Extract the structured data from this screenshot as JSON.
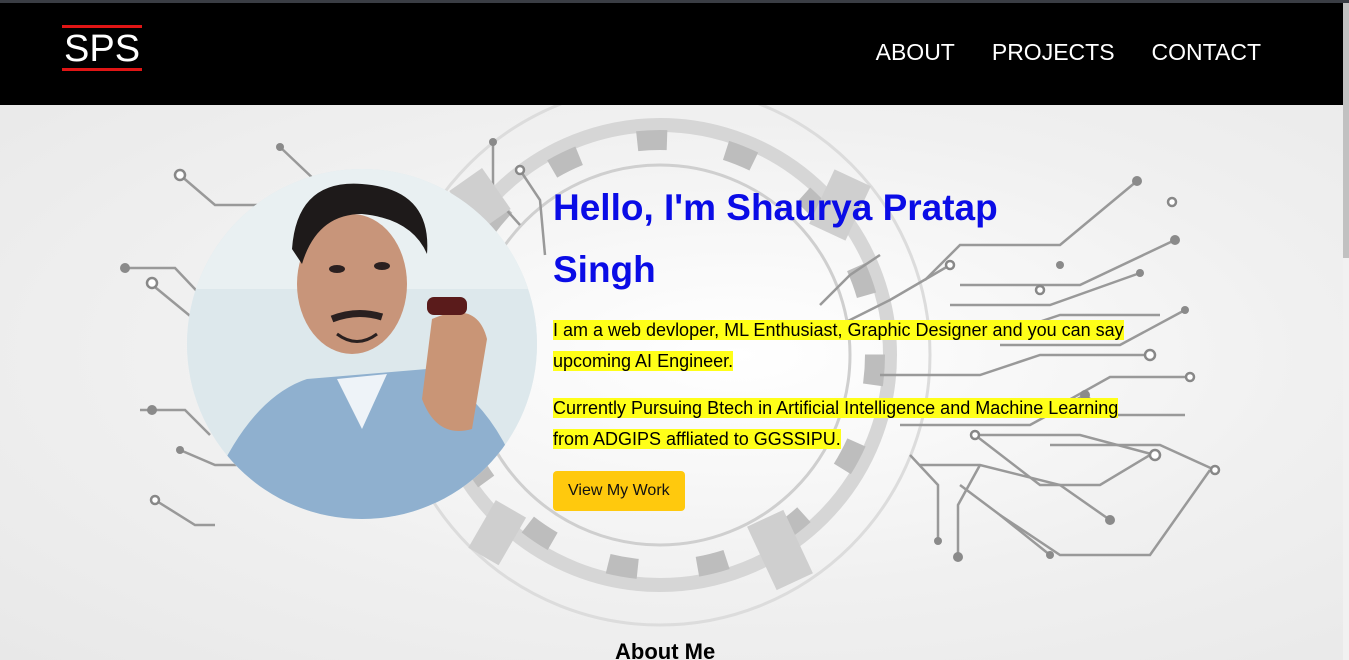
{
  "nav": {
    "logo": "SPS",
    "links": [
      "ABOUT",
      "PROJECTS",
      "CONTACT"
    ]
  },
  "hero": {
    "headline": "Hello, I'm Shaurya Pratap Singh",
    "paragraph1": "I am a web devloper, ML Enthusiast, Graphic Designer and you can say upcoming AI Engineer.",
    "paragraph2": "Currently Pursuing Btech in Artificial Intelligence and Machine Learning from ADGIPS affliated to GGSSIPU.",
    "button_label": "View My Work"
  },
  "about": {
    "title": "About Me"
  },
  "colors": {
    "nav_background": "#000000",
    "logo_accent": "#e01515",
    "headline": "#0a0ce6",
    "highlight": "#ffff18",
    "button": "#ffc90d"
  }
}
